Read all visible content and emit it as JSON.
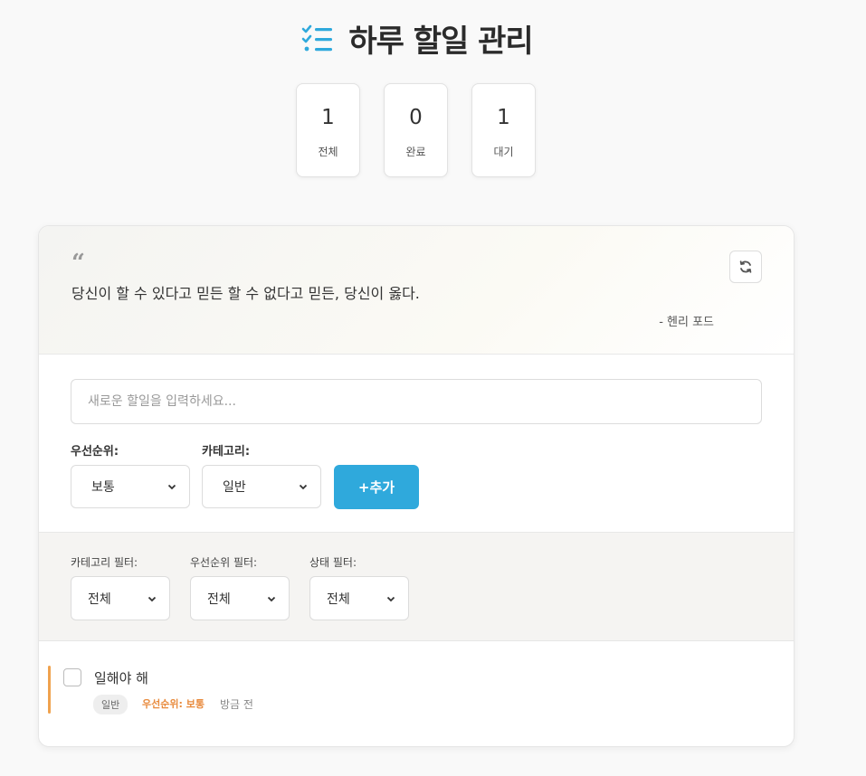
{
  "header": {
    "title": "하루 할일 관리",
    "icon": "checklist-icon",
    "accent": "#2fa9dc"
  },
  "stats": [
    {
      "value": "1",
      "label": "전체"
    },
    {
      "value": "0",
      "label": "완료"
    },
    {
      "value": "1",
      "label": "대기"
    }
  ],
  "quote": {
    "mark": "“",
    "text": "당신이 할 수 있다고 믿든 할 수 없다고 믿든, 당신이 옳다.",
    "author": "- 헨리 포드",
    "refresh_icon": "refresh-icon"
  },
  "form": {
    "placeholder": "새로운 할일을 입력하세요...",
    "priority_label": "우선순위:",
    "priority_value": "보통",
    "category_label": "카테고리:",
    "category_value": "일반",
    "add_label": "+추가"
  },
  "filters": {
    "category_label": "카테고리 필터:",
    "category_value": "전체",
    "priority_label": "우선순위 필터:",
    "priority_value": "전체",
    "status_label": "상태 필터:",
    "status_value": "전체"
  },
  "todos": [
    {
      "title": "일해야 해",
      "category": "일반",
      "priority": "우선순위: 보통",
      "time": "방금 전",
      "priority_color": "#e88a3c"
    }
  ]
}
